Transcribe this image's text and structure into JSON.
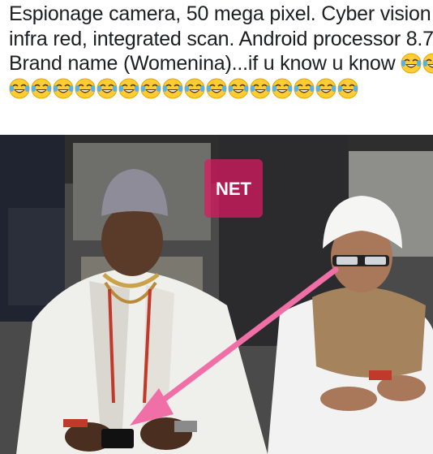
{
  "post": {
    "caption": "Espionage camera, 50 mega pixel. Cyber vision infra red, integrated scan. Android processor 8.7. Brand name (Womenina)...if u know u know",
    "emoji": {
      "name": "face-with-tears-of-joy-icon",
      "count": 18
    }
  },
  "photo": {
    "watermark_text": "NET",
    "arrow_color": "#f06fa6",
    "watermark_color": "#d81b60"
  }
}
